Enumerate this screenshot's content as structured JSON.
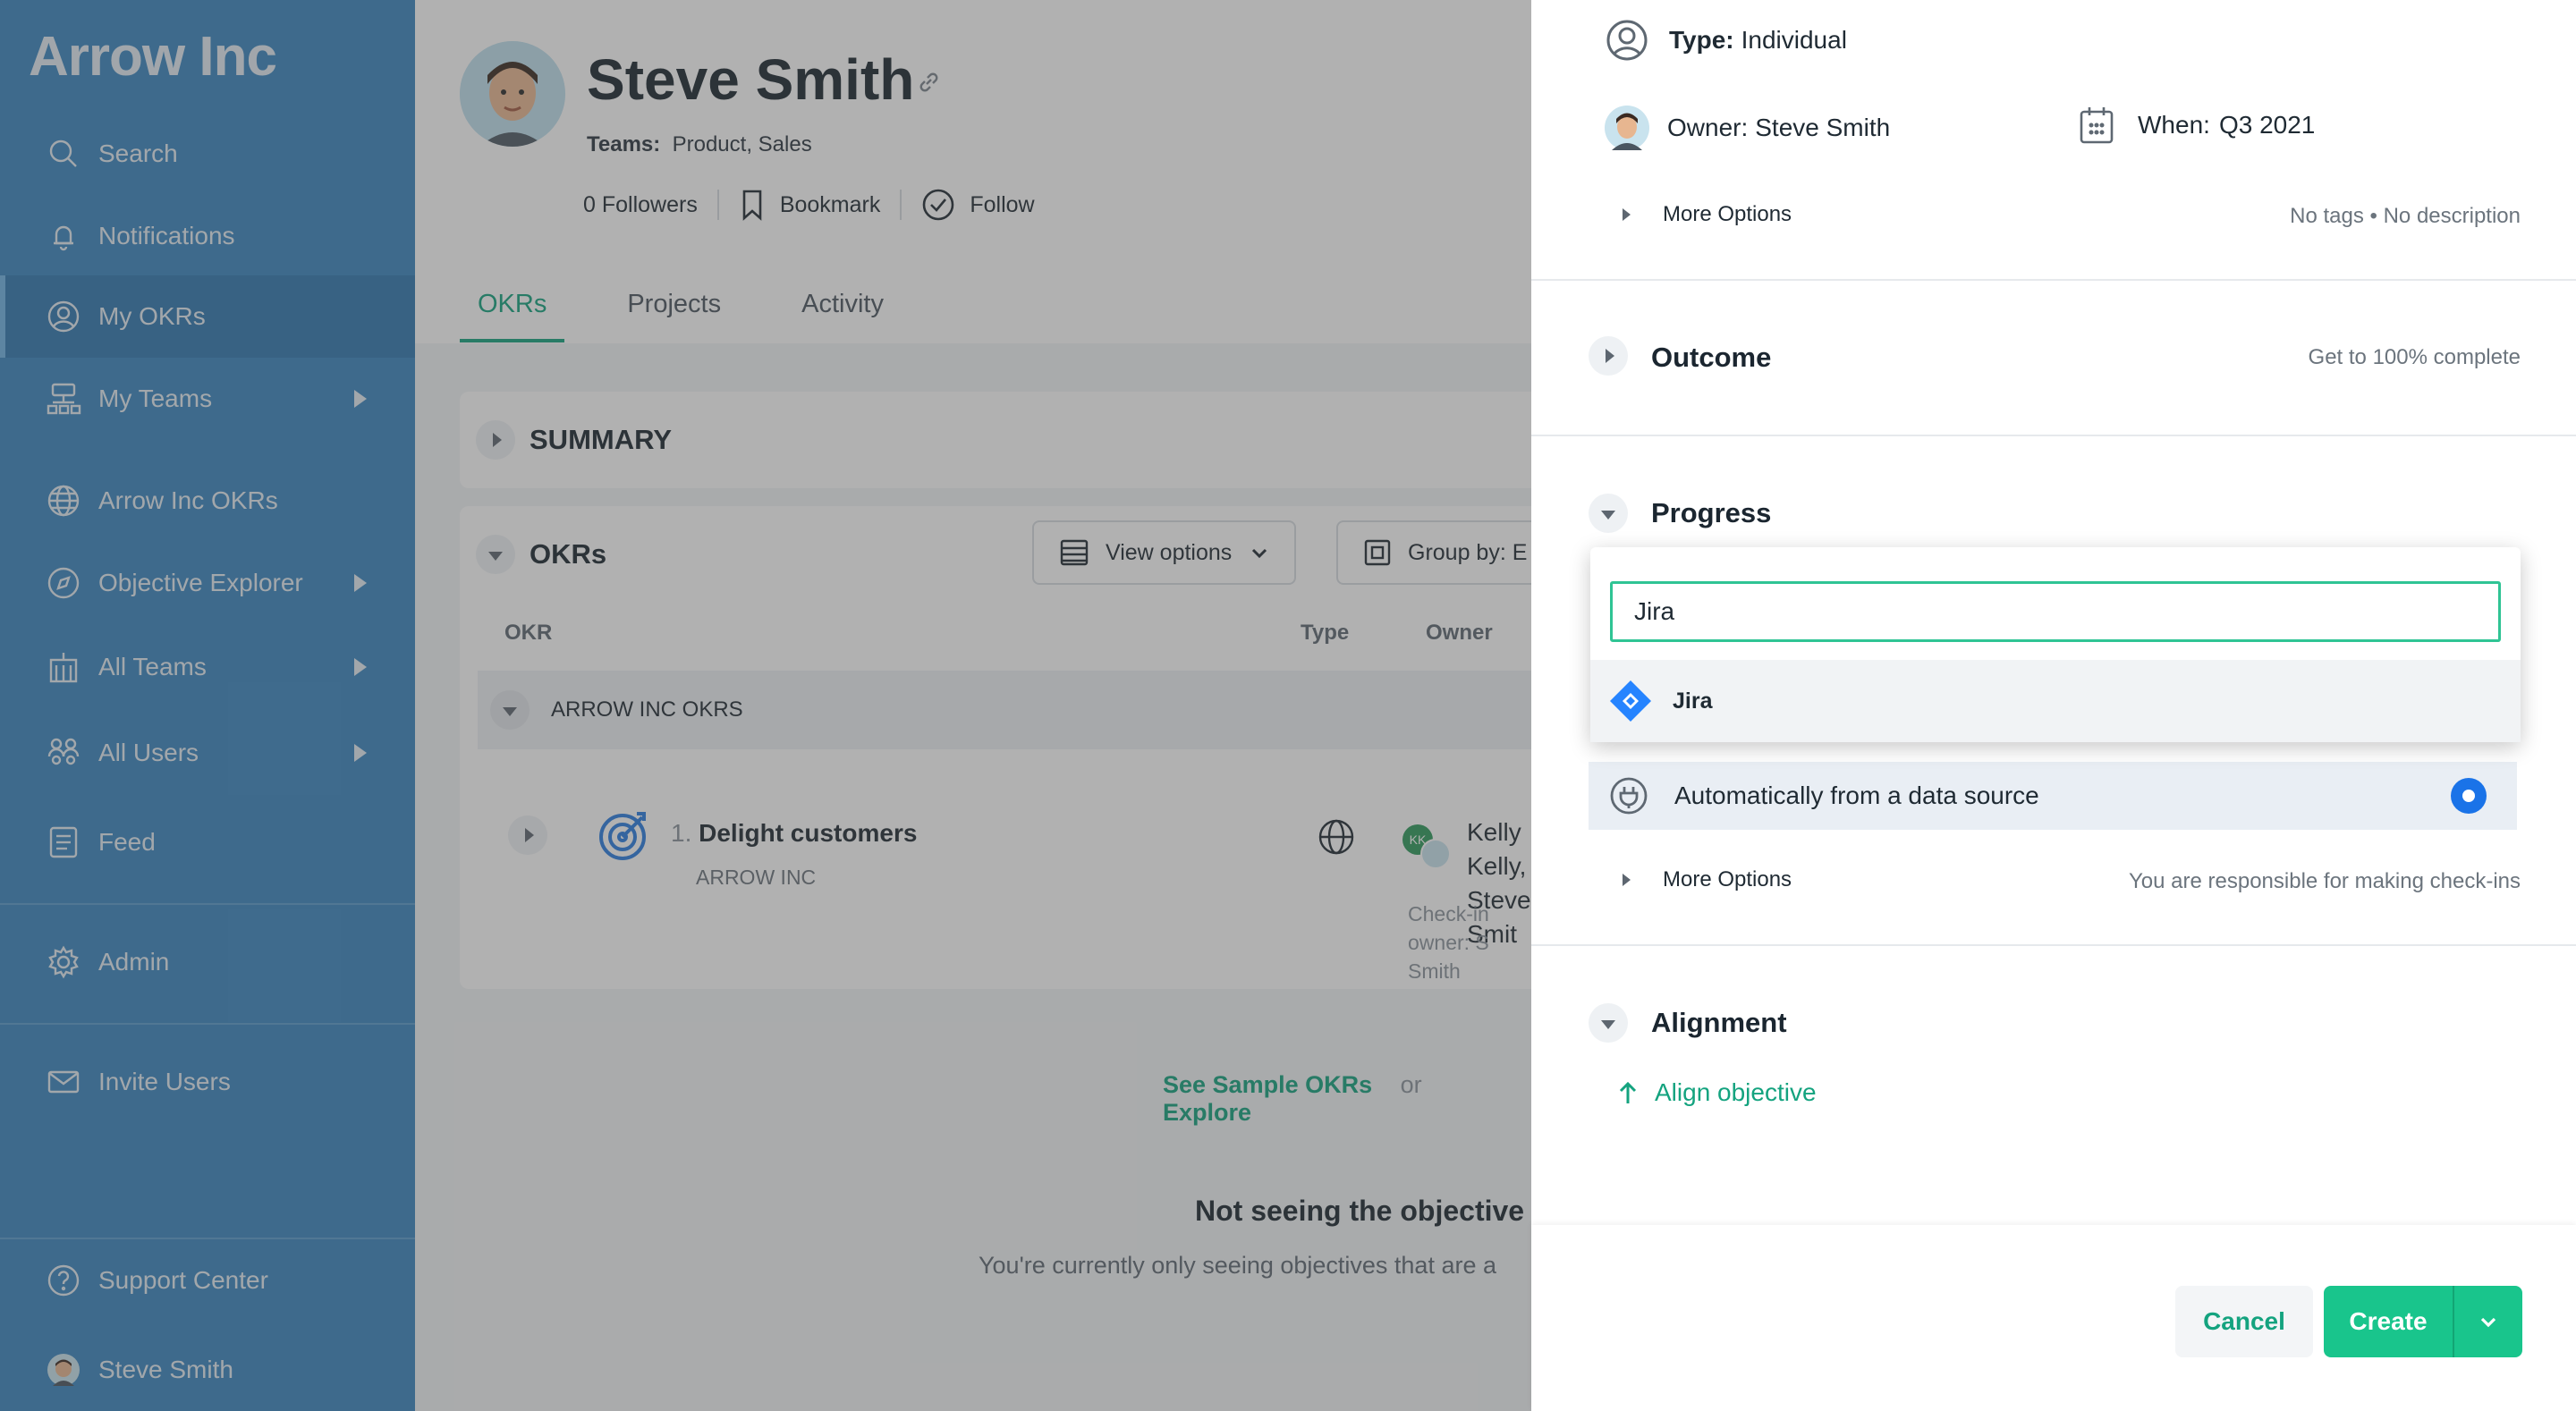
{
  "sidebar": {
    "brand": "Arrow Inc",
    "items": [
      {
        "label": "Search",
        "icon": "search-icon"
      },
      {
        "label": "Notifications",
        "icon": "bell-icon"
      },
      {
        "label": "My OKRs",
        "icon": "user-circle-icon"
      },
      {
        "label": "My Teams",
        "icon": "org-chart-icon"
      },
      {
        "label": "Arrow Inc OKRs",
        "icon": "globe-icon"
      },
      {
        "label": "Objective Explorer",
        "icon": "compass-icon"
      },
      {
        "label": "All Teams",
        "icon": "building-icon"
      },
      {
        "label": "All Users",
        "icon": "users-icon"
      },
      {
        "label": "Feed",
        "icon": "feed-icon"
      },
      {
        "label": "Admin",
        "icon": "gear-icon"
      },
      {
        "label": "Invite Users",
        "icon": "mail-icon"
      },
      {
        "label": "Support Center",
        "icon": "help-icon"
      },
      {
        "label": "Steve Smith",
        "icon": "avatar"
      }
    ]
  },
  "profile": {
    "name": "Steve Smith",
    "teams_label": "Teams:",
    "teams_value": "Product, Sales",
    "followers": "0 Followers",
    "bookmark": "Bookmark",
    "follow": "Follow"
  },
  "tabs": [
    "OKRs",
    "Projects",
    "Activity"
  ],
  "main": {
    "summary_title": "SUMMARY",
    "okrs_title": "OKRs",
    "view_options": "View options",
    "group_by": "Group by: E",
    "col_okr": "OKR",
    "col_type": "Type",
    "col_owner": "Owner",
    "group_name": "ARROW INC OKRS",
    "objective_number": "1.",
    "objective_title": "Delight customers",
    "objective_sub": "ARROW INC",
    "owner_names_1": "Kelly Kelly,",
    "owner_names_2": "Steve Smit",
    "owner_initials": "KK",
    "checkin_owner_1": "Check-in owner: S",
    "checkin_owner_2": "Smith",
    "see_sample": "See Sample OKRs",
    "or": "or",
    "explore": "Explore",
    "not_seeing": "Not seeing the objective",
    "only_seeing": "You're currently only seeing objectives that are a"
  },
  "panel": {
    "type_label": "Type:",
    "type_value": "Individual",
    "owner_label": "Owner:",
    "owner_value": "Steve Smith",
    "when_label": "When:",
    "when_value": "Q3 2021",
    "more_options": "More Options",
    "tags_desc": "No tags • No description",
    "outcome_title": "Outcome",
    "outcome_value": "Get to 100% complete",
    "progress_title": "Progress",
    "search_value": "Jira",
    "option_jira": "Jira",
    "auto_source": "Automatically from a data source",
    "more_options_2": "More Options",
    "responsibility": "You are responsible for making check-ins",
    "alignment_title": "Alignment",
    "align_objective": "Align objective",
    "cancel": "Cancel",
    "create": "Create"
  },
  "colors": {
    "sidebar": "#3a86c0",
    "accent_green": "#14a37f",
    "create_button": "#19c58c",
    "radio_blue": "#1a73e8",
    "jira_blue": "#2684ff"
  }
}
